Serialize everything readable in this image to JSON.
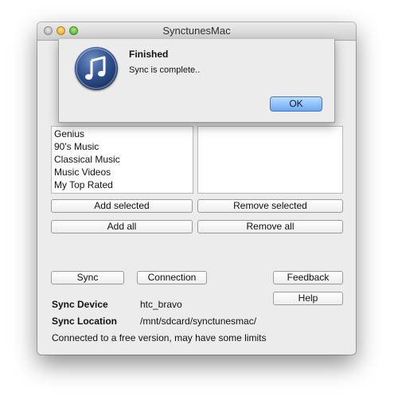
{
  "window": {
    "title": "SynctunesMac"
  },
  "playlists": [
    "Genius",
    "90's Music",
    "Classical Music",
    "Music Videos",
    "My Top Rated"
  ],
  "buttons": {
    "add_selected": "Add selected",
    "remove_selected": "Remove selected",
    "add_all": "Add all",
    "remove_all": "Remove all",
    "sync": "Sync",
    "connection": "Connection",
    "feedback": "Feedback",
    "help": "Help"
  },
  "info": {
    "device_label": "Sync Device",
    "device_value": "htc_bravo",
    "location_label": "Sync Location",
    "location_value": "/mnt/sdcard/synctunesmac/",
    "status": "Connected to a free version, may have some limits"
  },
  "dialog": {
    "title": "Finished",
    "message": "Sync is complete..",
    "ok": "OK"
  }
}
